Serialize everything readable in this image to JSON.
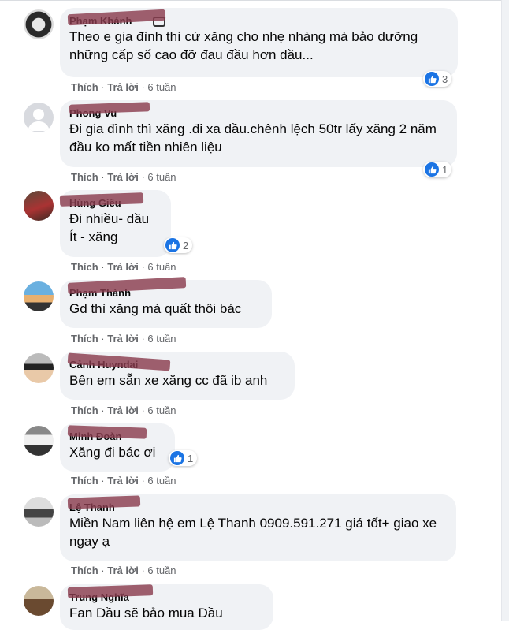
{
  "comments": [
    {
      "name": "Phạm Khánh",
      "text": "Theo e gia đình thì cứ xăng cho nhẹ nhàng mà bảo dưỡng những cấp số cao đỡ đau đầu hơn dầu...",
      "like": "Thích",
      "reply": "Trả lời",
      "time": "6 tuần",
      "reactions": "3"
    },
    {
      "name": "Phong Vu",
      "text": "Đi gia đình thì xăng .đi xa dầu.chênh lệch 50tr lấy xăng 2 năm đầu ko mất tiền nhiên liệu",
      "like": "Thích",
      "reply": "Trả lời",
      "time": "6 tuần",
      "reactions": "1"
    },
    {
      "name": "Hùng Giêu",
      "text": "Đi nhiều- dầu\nÍt - xăng",
      "like": "Thích",
      "reply": "Trả lời",
      "time": "6 tuần",
      "reactions": "2"
    },
    {
      "name": "Phạm Thành",
      "text": "Gd thì xăng mà quất thôi bác",
      "like": "Thích",
      "reply": "Trả lời",
      "time": "6 tuần"
    },
    {
      "name": "Cảnh Huyndai",
      "text": "Bên em sẵn xe xăng cc đã ib anh",
      "like": "Thích",
      "reply": "Trả lời",
      "time": "6 tuần"
    },
    {
      "name": "Minh Đoàn",
      "text": "Xăng đi bác ơi",
      "like": "Thích",
      "reply": "Trả lời",
      "time": "6 tuần",
      "reactions": "1"
    },
    {
      "name": "Lệ Thanh",
      "text": "Miền Nam liên hệ em Lệ Thanh 0909.591.271 giá tốt+ giao xe ngay ạ",
      "like": "Thích",
      "reply": "Trả lời",
      "time": "6 tuần"
    },
    {
      "name": "Trung Nghĩa",
      "text": "Fan Dầu sẽ bảo mua Dầu"
    }
  ],
  "colors": {
    "bubble": "#f0f2f5",
    "like_blue": "#1b74e4",
    "meta_gray": "#65676b",
    "redaction": "#8a3d4f"
  }
}
